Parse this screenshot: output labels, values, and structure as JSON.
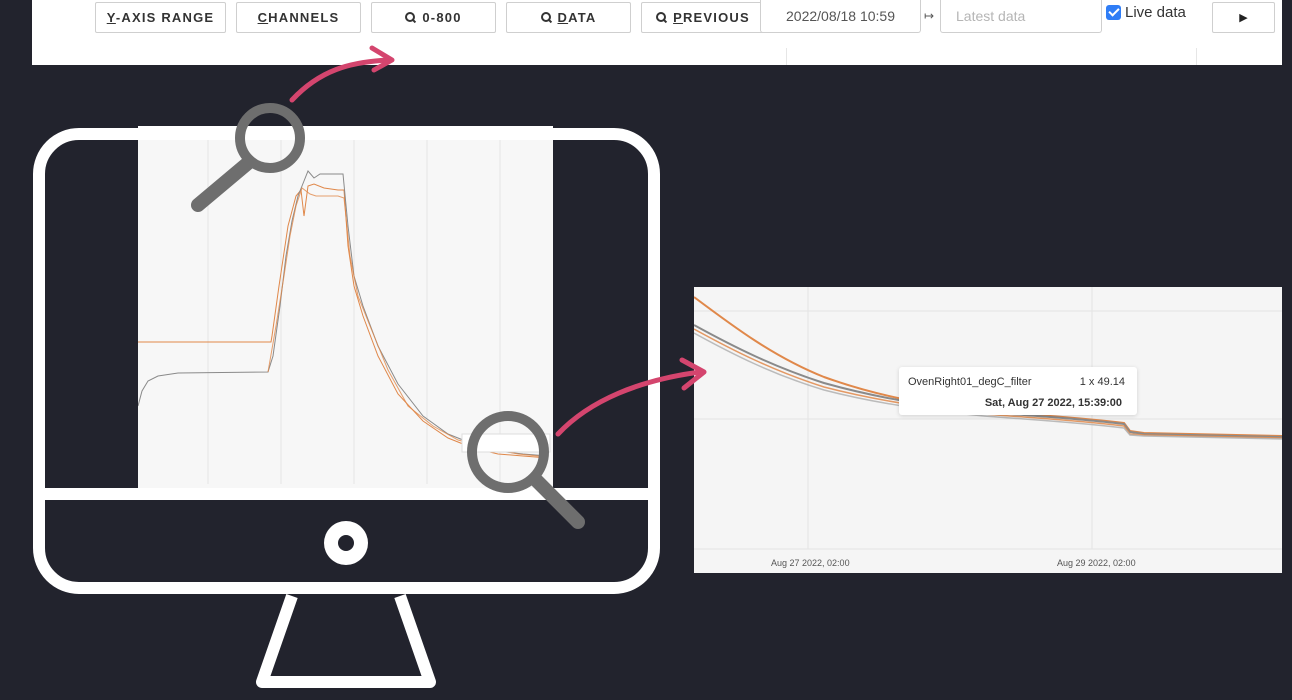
{
  "toolbar": {
    "buttons": [
      {
        "underline": "Y",
        "rest": "-AXIS RANGE"
      },
      {
        "underline": "C",
        "rest": "HANNELS"
      },
      {
        "underline": "",
        "rest": "0-800"
      },
      {
        "underline": "D",
        "rest": "ATA"
      },
      {
        "underline": "P",
        "rest": "REVIOUS"
      }
    ],
    "start_date": "2022/08/18 10:59",
    "end_placeholder": "Latest data",
    "live_label": "Live data",
    "play_label": "▶",
    "range_arrow": "↦"
  },
  "zoom": {
    "tick_labels": [
      "Aug 27 2022, 02:00",
      "Aug 29 2022, 02:00"
    ],
    "tooltip": {
      "series": "OvenRight01_degC_filter",
      "value": "1 x 49.14",
      "date": "Sat, Aug 27 2022, 15:39:00"
    }
  },
  "colors": {
    "background": "#22232d",
    "highlight_arrow": "#d4456e",
    "magnifier": "#6e6e6e",
    "series_orange": "#e0884a",
    "series_gray": "#8a8a8a",
    "checkbox": "#2f7df6"
  }
}
